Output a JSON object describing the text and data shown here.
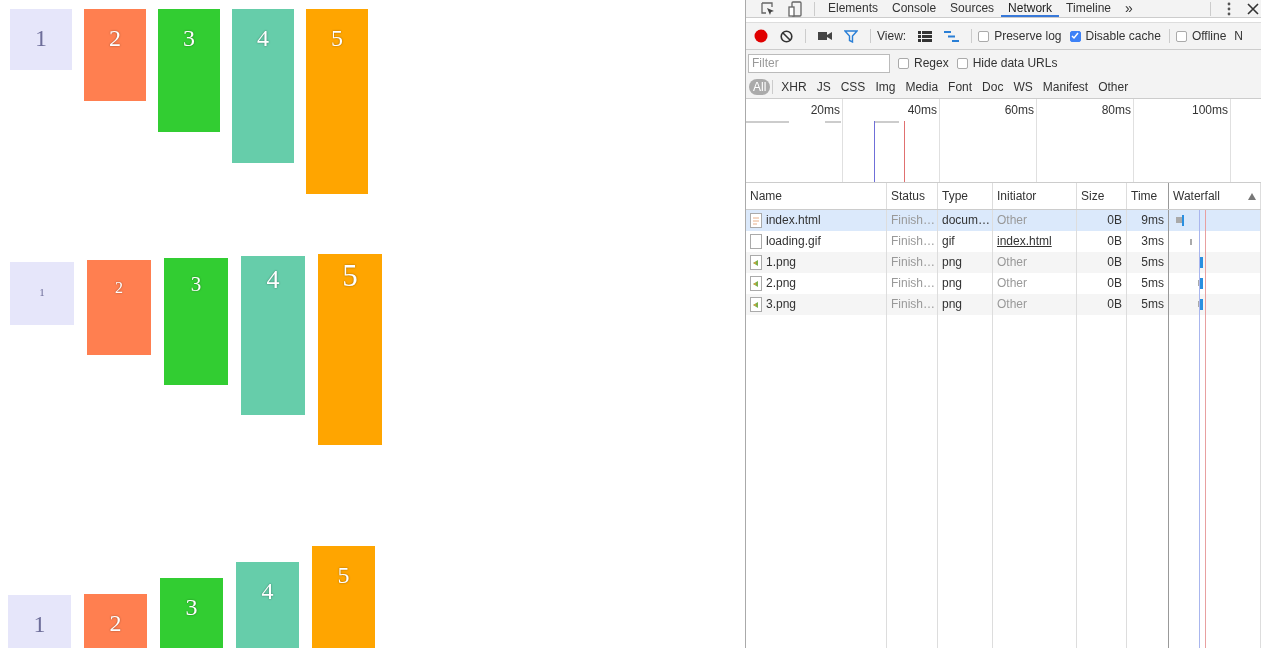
{
  "canvas": {
    "rows": [
      {
        "kind": "top",
        "boxes": [
          {
            "label": "1",
            "color": "#e6e6fa"
          },
          {
            "label": "2",
            "color": "#ff7f50"
          },
          {
            "label": "3",
            "color": "#32cd32"
          },
          {
            "label": "4",
            "color": "#66cdaa"
          },
          {
            "label": "5",
            "color": "#ffa500"
          }
        ]
      },
      {
        "kind": "scaled",
        "boxes": [
          {
            "label": "1",
            "color": "#e6e6fa"
          },
          {
            "label": "2",
            "color": "#ff7f50"
          },
          {
            "label": "3",
            "color": "#32cd32"
          },
          {
            "label": "4",
            "color": "#66cdaa"
          },
          {
            "label": "5",
            "color": "#ffa500"
          }
        ]
      },
      {
        "kind": "bottom",
        "boxes": [
          {
            "label": "1",
            "color": "#e6e6fa"
          },
          {
            "label": "2",
            "color": "#ff7f50"
          },
          {
            "label": "3",
            "color": "#32cd32"
          },
          {
            "label": "4",
            "color": "#66cdaa"
          },
          {
            "label": "5",
            "color": "#ffa500"
          }
        ]
      }
    ]
  },
  "devtools": {
    "tabs": [
      {
        "label": "Elements",
        "selected": false
      },
      {
        "label": "Console",
        "selected": false
      },
      {
        "label": "Sources",
        "selected": false
      },
      {
        "label": "Network",
        "selected": true
      },
      {
        "label": "Timeline",
        "selected": false
      }
    ],
    "more_tabs": "»",
    "toolbar": {
      "view_label": "View:",
      "options": [
        {
          "label": "Preserve log",
          "checked": false
        },
        {
          "label": "Disable cache",
          "checked": true
        },
        {
          "label": "Offline",
          "checked": false
        }
      ],
      "cut_label": "N"
    },
    "filter": {
      "placeholder": "Filter",
      "options": [
        {
          "label": "Regex",
          "checked": false
        },
        {
          "label": "Hide data URLs",
          "checked": false
        }
      ]
    },
    "types": [
      {
        "label": "All",
        "selected": true
      },
      {
        "label": "XHR",
        "selected": false
      },
      {
        "label": "JS",
        "selected": false
      },
      {
        "label": "CSS",
        "selected": false
      },
      {
        "label": "Img",
        "selected": false
      },
      {
        "label": "Media",
        "selected": false
      },
      {
        "label": "Font",
        "selected": false
      },
      {
        "label": "Doc",
        "selected": false
      },
      {
        "label": "WS",
        "selected": false
      },
      {
        "label": "Manifest",
        "selected": false
      },
      {
        "label": "Other",
        "selected": false
      }
    ],
    "overview_ticks": [
      "20ms",
      "40ms",
      "60ms",
      "80ms",
      "100ms"
    ],
    "table": {
      "columns": [
        "Name",
        "Status",
        "Type",
        "Initiator",
        "Size",
        "Time",
        "Waterfall"
      ],
      "rows": [
        {
          "name": "index.html",
          "kind": "document",
          "status": "Finish…",
          "type": "docum…",
          "initiator": "Other",
          "initiator_link": false,
          "size": "0B",
          "time": "9ms",
          "selected": true
        },
        {
          "name": "loading.gif",
          "kind": "blank",
          "status": "Finish…",
          "type": "gif",
          "initiator": "index.html",
          "initiator_link": true,
          "size": "0B",
          "time": "3ms",
          "selected": false
        },
        {
          "name": "1.png",
          "kind": "image",
          "status": "Finish…",
          "type": "png",
          "initiator": "Other",
          "initiator_link": false,
          "size": "0B",
          "time": "5ms",
          "selected": false
        },
        {
          "name": "2.png",
          "kind": "image",
          "status": "Finish…",
          "type": "png",
          "initiator": "Other",
          "initiator_link": false,
          "size": "0B",
          "time": "5ms",
          "selected": false
        },
        {
          "name": "3.png",
          "kind": "image",
          "status": "Finish…",
          "type": "png",
          "initiator": "Other",
          "initiator_link": false,
          "size": "0B",
          "time": "5ms",
          "selected": false
        }
      ]
    }
  }
}
